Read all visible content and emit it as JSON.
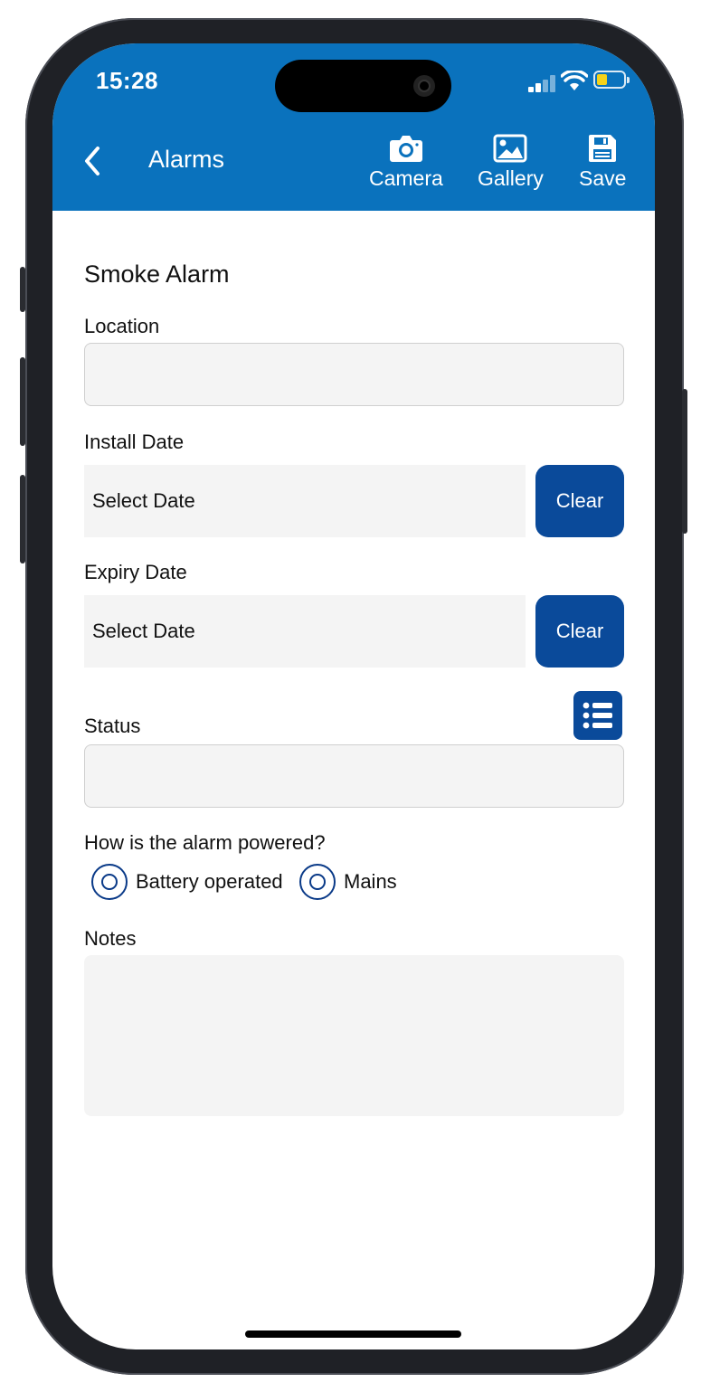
{
  "status_bar": {
    "time": "15:28"
  },
  "nav": {
    "title": "Alarms",
    "tools": [
      {
        "label": "Camera",
        "icon": "camera-icon"
      },
      {
        "label": "Gallery",
        "icon": "image-icon"
      },
      {
        "label": "Save",
        "icon": "floppy-disk-icon"
      }
    ]
  },
  "form": {
    "section_title": "Smoke Alarm",
    "location": {
      "label": "Location",
      "value": ""
    },
    "install_date": {
      "label": "Install Date",
      "value": "Select Date",
      "clear_label": "Clear"
    },
    "expiry_date": {
      "label": "Expiry Date",
      "value": "Select Date",
      "clear_label": "Clear"
    },
    "status": {
      "label": "Status",
      "value": "",
      "list_icon": "list-icon"
    },
    "power": {
      "question": "How is the alarm powered?",
      "options": [
        "Battery operated",
        "Mains"
      ]
    },
    "notes": {
      "label": "Notes",
      "value": ""
    }
  },
  "colors": {
    "header_blue": "#0a72bd",
    "button_blue": "#0a4a9a",
    "radio_blue": "#0a3a88",
    "input_bg": "#f4f4f4"
  }
}
